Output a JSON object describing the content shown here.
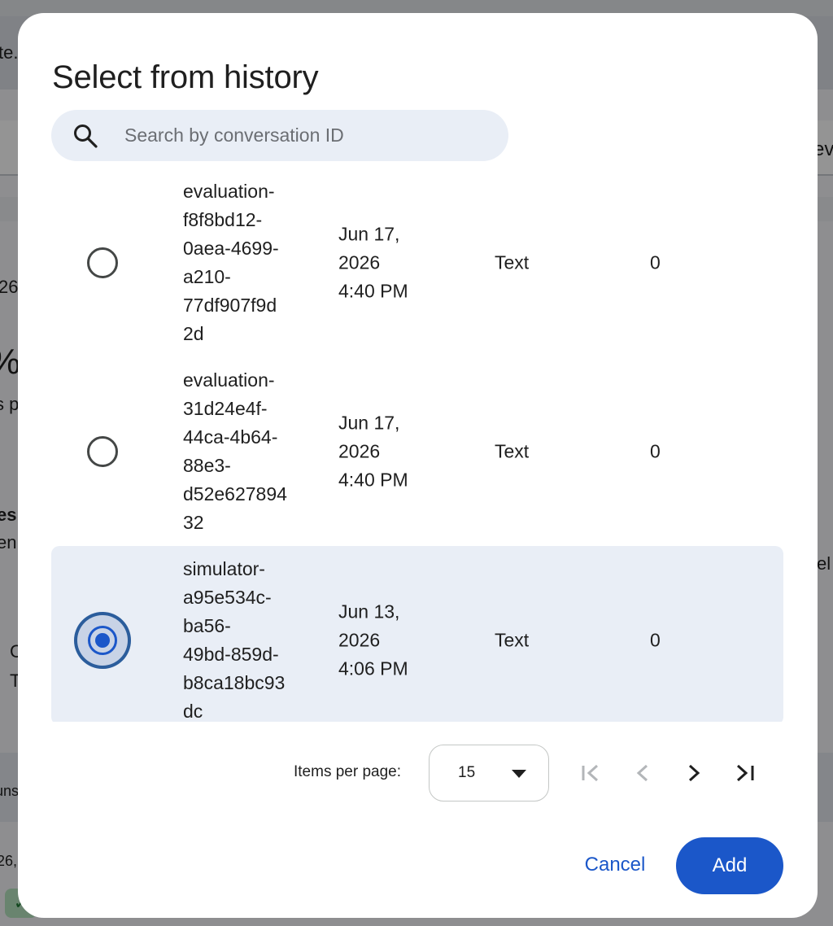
{
  "dialog": {
    "title": "Select from history",
    "search": {
      "placeholder": "Search by conversation ID",
      "value": "",
      "icon": "search-icon"
    },
    "rows": [
      {
        "conversation_id": "evaluation-f8f8bd12-0aea-4699-a210-77df907f9d2d",
        "conversation_id_display": "evaluation-\nf8f8bd12-\n0aea-4699-\na210-\n77df907f9d\n2d",
        "date": "Jun 17,\n2026\n4:40 PM",
        "type": "Text",
        "count": "0",
        "selected": false
      },
      {
        "conversation_id": "evaluation-31d24e4f-44ca-4b64-88e3-d52e62789432",
        "conversation_id_display": "evaluation-\n31d24e4f-\n44ca-4b64-\n88e3-\nd52e627894\n32",
        "date": "Jun 17,\n2026\n4:40 PM",
        "type": "Text",
        "count": "0",
        "selected": false
      },
      {
        "conversation_id": "simulator-a95e534c-ba56-49bd-859d-b8ca18bc93dc",
        "conversation_id_display": "simulator-\na95e534c-\nba56-\n49bd-859d-\nb8ca18bc93\ndc",
        "date": "Jun 13,\n2026\n4:06 PM",
        "type": "Text",
        "count": "0",
        "selected": true
      }
    ],
    "paginator": {
      "items_per_page_label": "Items per page:",
      "items_per_page_value": "15",
      "first_page_icon": "first-page-icon",
      "prev_page_icon": "chevron-left-icon",
      "next_page_icon": "chevron-right-icon",
      "last_page_icon": "last-page-icon"
    },
    "actions": {
      "cancel_label": "Cancel",
      "add_label": "Add"
    }
  },
  "background": {
    "fragments": [
      "te.",
      "ev",
      "26",
      "%",
      "s p",
      "es",
      "en",
      "el",
      "C",
      "T",
      "uns",
      "26,"
    ]
  },
  "colors": {
    "primary": "#1b57c9",
    "selected_row": "#e9eef6",
    "search_bg": "#e9eef6",
    "text": "#1f1f1f"
  }
}
